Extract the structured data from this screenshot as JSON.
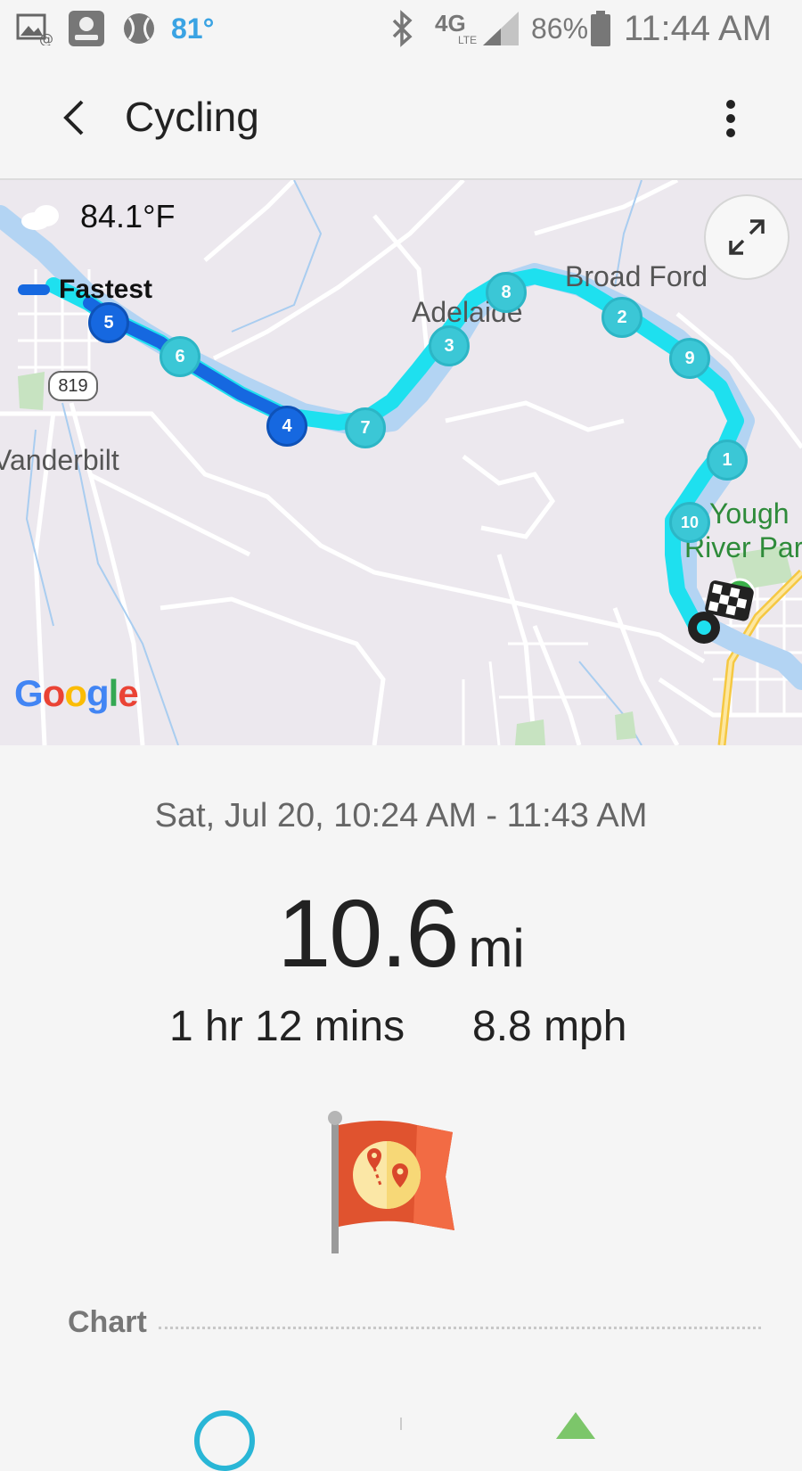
{
  "status_bar": {
    "weather_temp": "81°",
    "network": "4G",
    "network_sub": "LTE",
    "battery": "86%",
    "time": "11:44 AM",
    "icons": [
      "image-notification-icon",
      "nbc-sports-icon",
      "baseball-icon",
      "bluetooth-icon",
      "lte-icon",
      "signal-icon",
      "battery-icon"
    ]
  },
  "app_bar": {
    "title": "Cycling",
    "back_icon": "chevron-left-icon",
    "more_icon": "more-vert-icon"
  },
  "map": {
    "weather_temp": "84.1°F",
    "legend_label": "Fastest",
    "place_labels": {
      "adelaide": "Adelaide",
      "broad_ford": "Broad Ford",
      "vanderbilt": "Vanderbilt",
      "yough_line1": "Yough",
      "yough_line2": "River Park"
    },
    "road_shield": "819",
    "google_logo": [
      "G",
      "o",
      "o",
      "g",
      "l",
      "e"
    ],
    "google_colors": [
      "#4285F4",
      "#EA4335",
      "#FBBC05",
      "#4285F4",
      "#34A853",
      "#EA4335"
    ],
    "route_color": "#1ee0ef",
    "fastest_color": "#1668e0",
    "markers": [
      "1",
      "2",
      "3",
      "4",
      "5",
      "6",
      "7",
      "8",
      "9",
      "10"
    ]
  },
  "summary": {
    "date_range": "Sat, Jul 20, 10:24 AM - 11:43 AM",
    "distance_value": "10.6",
    "distance_unit": "mi",
    "duration": "1 hr 12 mins",
    "speed": "8.8 mph",
    "badge_icon": "route-flag-icon",
    "chart_heading": "Chart"
  }
}
